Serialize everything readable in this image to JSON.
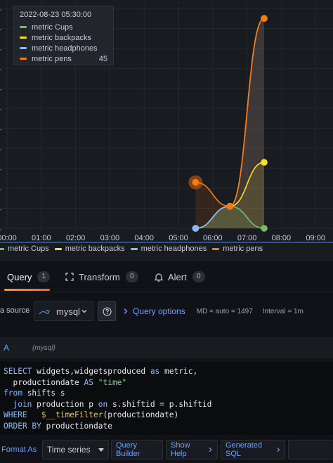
{
  "tooltip": {
    "time": "2022-08-23 05:30:00",
    "rows": [
      {
        "name": "metric Cups",
        "value": "",
        "color": "#73bf69"
      },
      {
        "name": "metric backpacks",
        "value": "",
        "color": "#fade2a"
      },
      {
        "name": "metric headphones",
        "value": "",
        "color": "#8ab8ff"
      },
      {
        "name": "metric pens",
        "value": "45",
        "color": "#ff780a"
      }
    ]
  },
  "chart_data": {
    "type": "line",
    "x_ticks": [
      "00:00",
      "01:00",
      "02:00",
      "03:00",
      "04:00",
      "05:00",
      "06:00",
      "07:00",
      "08:00",
      "09:00"
    ],
    "x": [
      "05:30",
      "06:30",
      "07:30"
    ],
    "series": [
      {
        "name": "metric Cups",
        "color": "#73bf69",
        "values": [
          0,
          11,
          0
        ]
      },
      {
        "name": "metric backpacks",
        "color": "#fade2a",
        "values": [
          0,
          11,
          33
        ]
      },
      {
        "name": "metric headphones",
        "color": "#8ab8ff",
        "values": [
          0,
          11,
          105
        ]
      },
      {
        "name": "metric pens",
        "color": "#ff780a",
        "values": [
          23,
          11,
          105
        ]
      }
    ],
    "ylim": [
      0,
      110
    ],
    "legend": "bottom",
    "grid": true
  },
  "legend": [
    {
      "name": "metric Cups",
      "color": "#73bf69"
    },
    {
      "name": "metric backpacks",
      "color": "#fade2a"
    },
    {
      "name": "metric headphones",
      "color": "#8ab8ff"
    },
    {
      "name": "metric pens",
      "color": "#ff780a"
    }
  ],
  "tabs": [
    {
      "label": "Query",
      "count": "1"
    },
    {
      "label": "Transform",
      "count": "0"
    },
    {
      "label": "Alert",
      "count": "0"
    }
  ],
  "datasource": {
    "label": "a source",
    "name": "mysql"
  },
  "query_options": {
    "title": "Query options",
    "md": "MD = auto = 1497",
    "interval": "Interval = 1m"
  },
  "query": {
    "ref": "A",
    "datasource": "(mysql)"
  },
  "toolbar": {
    "format_as": "Format As",
    "format_value": "Time series",
    "query_builder": "Query Builder",
    "show_help": "Show Help",
    "generated_sql": "Generated SQL"
  }
}
